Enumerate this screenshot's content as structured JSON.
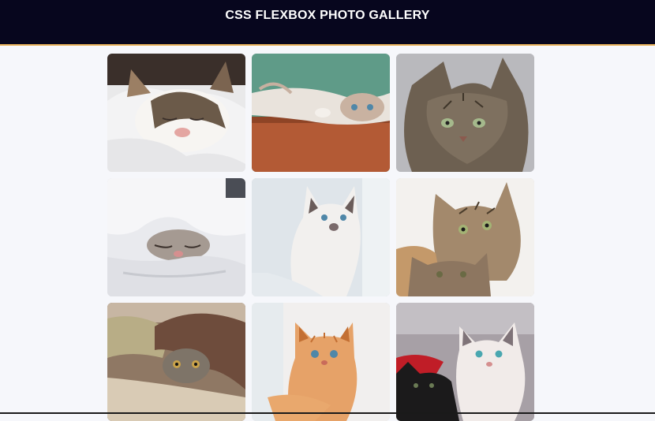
{
  "header": {
    "title": "CSS FLEXBOX PHOTO GALLERY",
    "accent_color": "#e8b15a",
    "background_color": "#07061e"
  },
  "gallery": {
    "photos": [
      {
        "subject": "sleeping-tabby-white-cat",
        "bg": "#ececec",
        "fur": "#f4f2ef",
        "patch": "#6b5a49"
      },
      {
        "subject": "kitten-lying-on-wood-floor",
        "bg": "#5f9b88",
        "fur": "#e8e2da",
        "patch": "#9e7a63"
      },
      {
        "subject": "tabby-cat-portrait",
        "bg": "#b9b9bd",
        "fur": "#6d6051",
        "patch": "#3e3529"
      },
      {
        "subject": "cat-under-white-blanket",
        "bg": "#e9eaee",
        "fur": "#a59a92",
        "patch": "#5a4d45"
      },
      {
        "subject": "white-siamese-kitten",
        "bg": "#dfe5ea",
        "fur": "#f2f0ee",
        "patch": "#6a5c5a"
      },
      {
        "subject": "two-tabby-kittens",
        "bg": "#f3f1ee",
        "fur": "#a3896c",
        "patch": "#4b3d2c"
      },
      {
        "subject": "cat-under-knitted-blanket",
        "bg": "#8f7864",
        "fur": "#7e7468",
        "patch": "#3d352c"
      },
      {
        "subject": "orange-kitten",
        "bg": "#f1efee",
        "fur": "#e6a268",
        "patch": "#c36f33"
      },
      {
        "subject": "black-and-white-kittens",
        "bg": "#a7a0a6",
        "fur": "#f1ebe9",
        "patch": "#1b1a1b"
      }
    ]
  }
}
